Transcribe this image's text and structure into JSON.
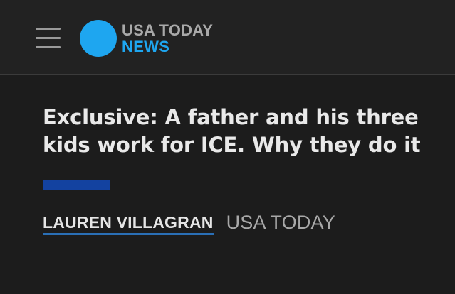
{
  "header": {
    "menu_icon": "hamburger-menu-icon",
    "logo": {
      "line1": "USA TODAY",
      "line2": "NEWS",
      "circle_color": "#1ea6f0",
      "news_color": "#1ea6f0"
    }
  },
  "article": {
    "headline": "Exclusive: A father and his three kids work for ICE. Why they do it",
    "accent_color": "#1342a0",
    "byline": {
      "author": "LAUREN VILLAGRAN",
      "publication": "USA TODAY"
    }
  }
}
